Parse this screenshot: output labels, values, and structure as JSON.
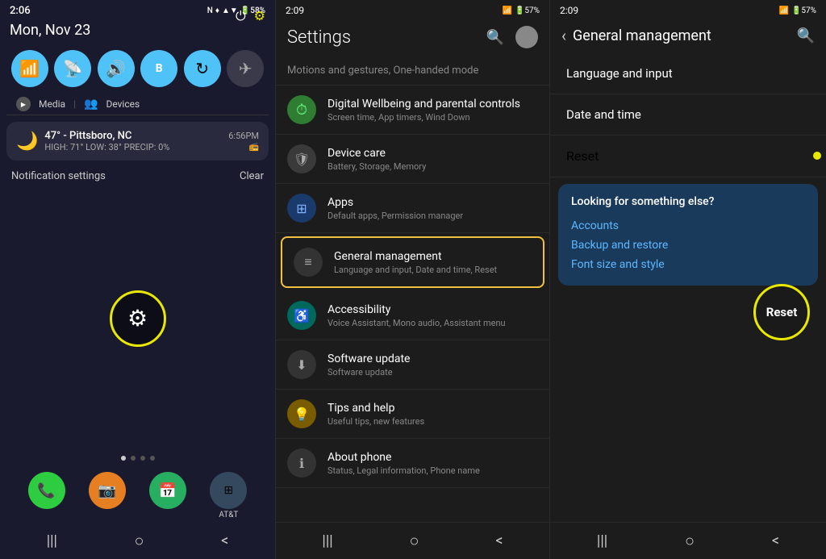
{
  "panel1": {
    "time": "2:06",
    "date": "Mon, Nov 23",
    "status_icons": "N ♦ 58%",
    "controls": [
      {
        "icon": "📶",
        "label": "wifi",
        "active": true
      },
      {
        "icon": "📡",
        "label": "wifi-calling",
        "active": true
      },
      {
        "icon": "🔊",
        "label": "sound",
        "active": true
      },
      {
        "icon": "⬤",
        "label": "bluetooth",
        "active": true
      },
      {
        "icon": "↻",
        "label": "sync",
        "active": true
      },
      {
        "icon": "✈",
        "label": "airplane",
        "active": false
      }
    ],
    "media_label": "Media",
    "devices_label": "Devices",
    "notification": {
      "icon": "🌙",
      "title": "47° - Pittsboro, NC",
      "subtitle": "HIGH: 71° LOW: 38° PRECIP: 0%",
      "time": "6:56PM"
    },
    "notif_settings": "Notification settings",
    "notif_clear": "Clear",
    "gear_label": "⚙",
    "apps": [
      {
        "icon": "📞",
        "color": "#2ecc40",
        "label": ""
      },
      {
        "icon": "📷",
        "color": "#e67e22",
        "label": ""
      },
      {
        "icon": "📅",
        "color": "#27ae60",
        "label": ""
      },
      {
        "icon": "⊞",
        "color": "#34495e",
        "label": "AT&T"
      }
    ],
    "nav": [
      "|||",
      "○",
      "<"
    ]
  },
  "panel2": {
    "time": "2:09",
    "status_icons": "57%",
    "title": "Settings",
    "items_above": [
      {
        "label": "Motions and gestures, One-handed mode",
        "sub": ""
      }
    ],
    "items": [
      {
        "name": "Digital Wellbeing and parental controls",
        "sub": "Screen time, App timers, Wind Down",
        "icon": "clock",
        "icon_type": "green"
      },
      {
        "name": "Device care",
        "sub": "Battery, Storage, Memory",
        "icon": "shield",
        "icon_type": "gray"
      },
      {
        "name": "Apps",
        "sub": "Default apps, Permission manager",
        "icon": "grid",
        "icon_type": "blue"
      },
      {
        "name": "General management",
        "sub": "Language and input, Date and time, Reset",
        "icon": "sliders",
        "icon_type": "gray",
        "highlighted": true
      },
      {
        "name": "Accessibility",
        "sub": "Voice Assistant, Mono audio, Assistant menu",
        "icon": "person",
        "icon_type": "teal"
      },
      {
        "name": "Software update",
        "sub": "Software update",
        "icon": "download",
        "icon_type": "gray"
      },
      {
        "name": "Tips and help",
        "sub": "Useful tips, new features",
        "icon": "bulb",
        "icon_type": "yellow"
      },
      {
        "name": "About phone",
        "sub": "Status, Legal information, Phone name",
        "icon": "info",
        "icon_type": "gray"
      }
    ],
    "nav": [
      "|||",
      "○",
      "<"
    ]
  },
  "panel3": {
    "time": "2:09",
    "status_icons": "57%",
    "title": "General management",
    "items": [
      {
        "label": "Language and input"
      },
      {
        "label": "Date and time"
      },
      {
        "label": "Reset"
      }
    ],
    "suggestion_box": {
      "title": "Looking for something else?",
      "links": [
        "Accounts",
        "Backup and restore",
        "Font size and style"
      ]
    },
    "reset_circle_label": "Reset",
    "nav": [
      "|||",
      "○",
      "<"
    ]
  }
}
